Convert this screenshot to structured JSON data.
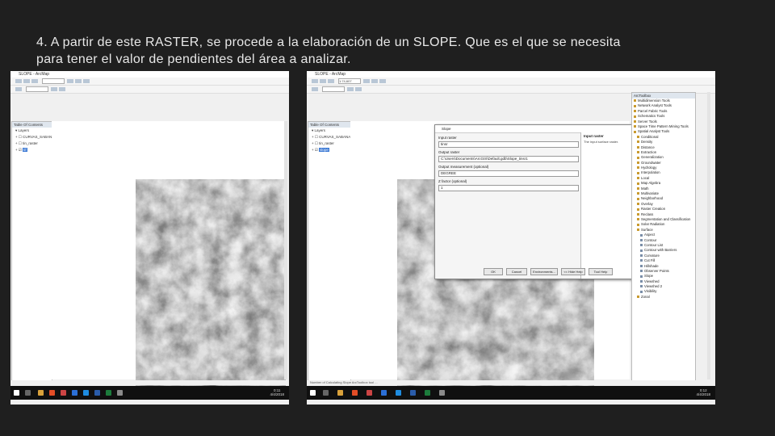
{
  "caption": {
    "line1": "4. A partir de este RASTER, se procede a la elaboración de un SLOPE. Que es el que se necesita",
    "line2": "para tener el valor de pendientes del área a analizar."
  },
  "left_window": {
    "title": "SLOPE - ArcMap",
    "toc_title": "Table Of Contents",
    "layers_label": "Layers",
    "layers": [
      "CURVAS_SABANA",
      "tin_raster",
      "tif"
    ],
    "clock_time": "0:11",
    "clock_date": "4/4/2018"
  },
  "right_window": {
    "title": "SLOPE - ArcMap",
    "toc_title": "Table Of Contents",
    "layers_label": "Layers",
    "layers": [
      "CURVAS_SABANA",
      "tin_raster",
      "slope"
    ],
    "scale": "1:74,607",
    "clock_time": "0:12",
    "clock_date": "4/4/2018",
    "status_text": "Number of Calculating Slope ArcToolbox tool ...",
    "dialog": {
      "title": "Slope",
      "input_label": "Input raster",
      "input_value": "tinsr",
      "output_label": "Output raster",
      "output_value": "C:\\Users\\Documents\\ArcGIS\\Default.gdb\\Slope_tinsr1",
      "measurement_label": "Output measurement (optional)",
      "measurement_value": "DEGREE",
      "zfactor_label": "Z factor (optional)",
      "zfactor_value": "1",
      "help_title": "Input raster",
      "help_body": "The input surface raster.",
      "btn_ok": "OK",
      "btn_cancel": "Cancel",
      "btn_env": "Environments...",
      "btn_help": "<< Hide Help",
      "btn_toolhelp": "Tool Help"
    },
    "arctoolbox": {
      "title": "ArcToolbox",
      "items": [
        {
          "label": "Multidimension Tools",
          "type": "box",
          "indent": 0
        },
        {
          "label": "Network Analyst Tools",
          "type": "box",
          "indent": 0
        },
        {
          "label": "Parcel Fabric Tools",
          "type": "box",
          "indent": 0
        },
        {
          "label": "Schematics Tools",
          "type": "box",
          "indent": 0
        },
        {
          "label": "Server Tools",
          "type": "box",
          "indent": 0
        },
        {
          "label": "Space Time Pattern Mining Tools",
          "type": "box",
          "indent": 0
        },
        {
          "label": "Spatial Analyst Tools",
          "type": "box",
          "indent": 0
        },
        {
          "label": "Conditional",
          "type": "box",
          "indent": 1
        },
        {
          "label": "Density",
          "type": "box",
          "indent": 1
        },
        {
          "label": "Distance",
          "type": "box",
          "indent": 1
        },
        {
          "label": "Extraction",
          "type": "box",
          "indent": 1
        },
        {
          "label": "Generalization",
          "type": "box",
          "indent": 1
        },
        {
          "label": "Groundwater",
          "type": "box",
          "indent": 1
        },
        {
          "label": "Hydrology",
          "type": "box",
          "indent": 1
        },
        {
          "label": "Interpolation",
          "type": "box",
          "indent": 1
        },
        {
          "label": "Local",
          "type": "box",
          "indent": 1
        },
        {
          "label": "Map Algebra",
          "type": "box",
          "indent": 1
        },
        {
          "label": "Math",
          "type": "box",
          "indent": 1
        },
        {
          "label": "Multivariate",
          "type": "box",
          "indent": 1
        },
        {
          "label": "Neighborhood",
          "type": "box",
          "indent": 1
        },
        {
          "label": "Overlay",
          "type": "box",
          "indent": 1
        },
        {
          "label": "Raster Creation",
          "type": "box",
          "indent": 1
        },
        {
          "label": "Reclass",
          "type": "box",
          "indent": 1
        },
        {
          "label": "Segmentation and Classification",
          "type": "box",
          "indent": 1
        },
        {
          "label": "Solar Radiation",
          "type": "box",
          "indent": 1
        },
        {
          "label": "Surface",
          "type": "box",
          "indent": 1
        },
        {
          "label": "Aspect",
          "type": "tool",
          "indent": 2
        },
        {
          "label": "Contour",
          "type": "tool",
          "indent": 2
        },
        {
          "label": "Contour List",
          "type": "tool",
          "indent": 2
        },
        {
          "label": "Contour with Barriers",
          "type": "tool",
          "indent": 2
        },
        {
          "label": "Curvature",
          "type": "tool",
          "indent": 2
        },
        {
          "label": "Cut Fill",
          "type": "tool",
          "indent": 2
        },
        {
          "label": "Hillshade",
          "type": "tool",
          "indent": 2
        },
        {
          "label": "Observer Points",
          "type": "tool",
          "indent": 2
        },
        {
          "label": "Slope",
          "type": "tool",
          "indent": 2
        },
        {
          "label": "Viewshed",
          "type": "tool",
          "indent": 2
        },
        {
          "label": "Viewshed 2",
          "type": "tool",
          "indent": 2
        },
        {
          "label": "Visibility",
          "type": "tool",
          "indent": 2
        },
        {
          "label": "Zonal",
          "type": "box",
          "indent": 1
        }
      ]
    }
  }
}
